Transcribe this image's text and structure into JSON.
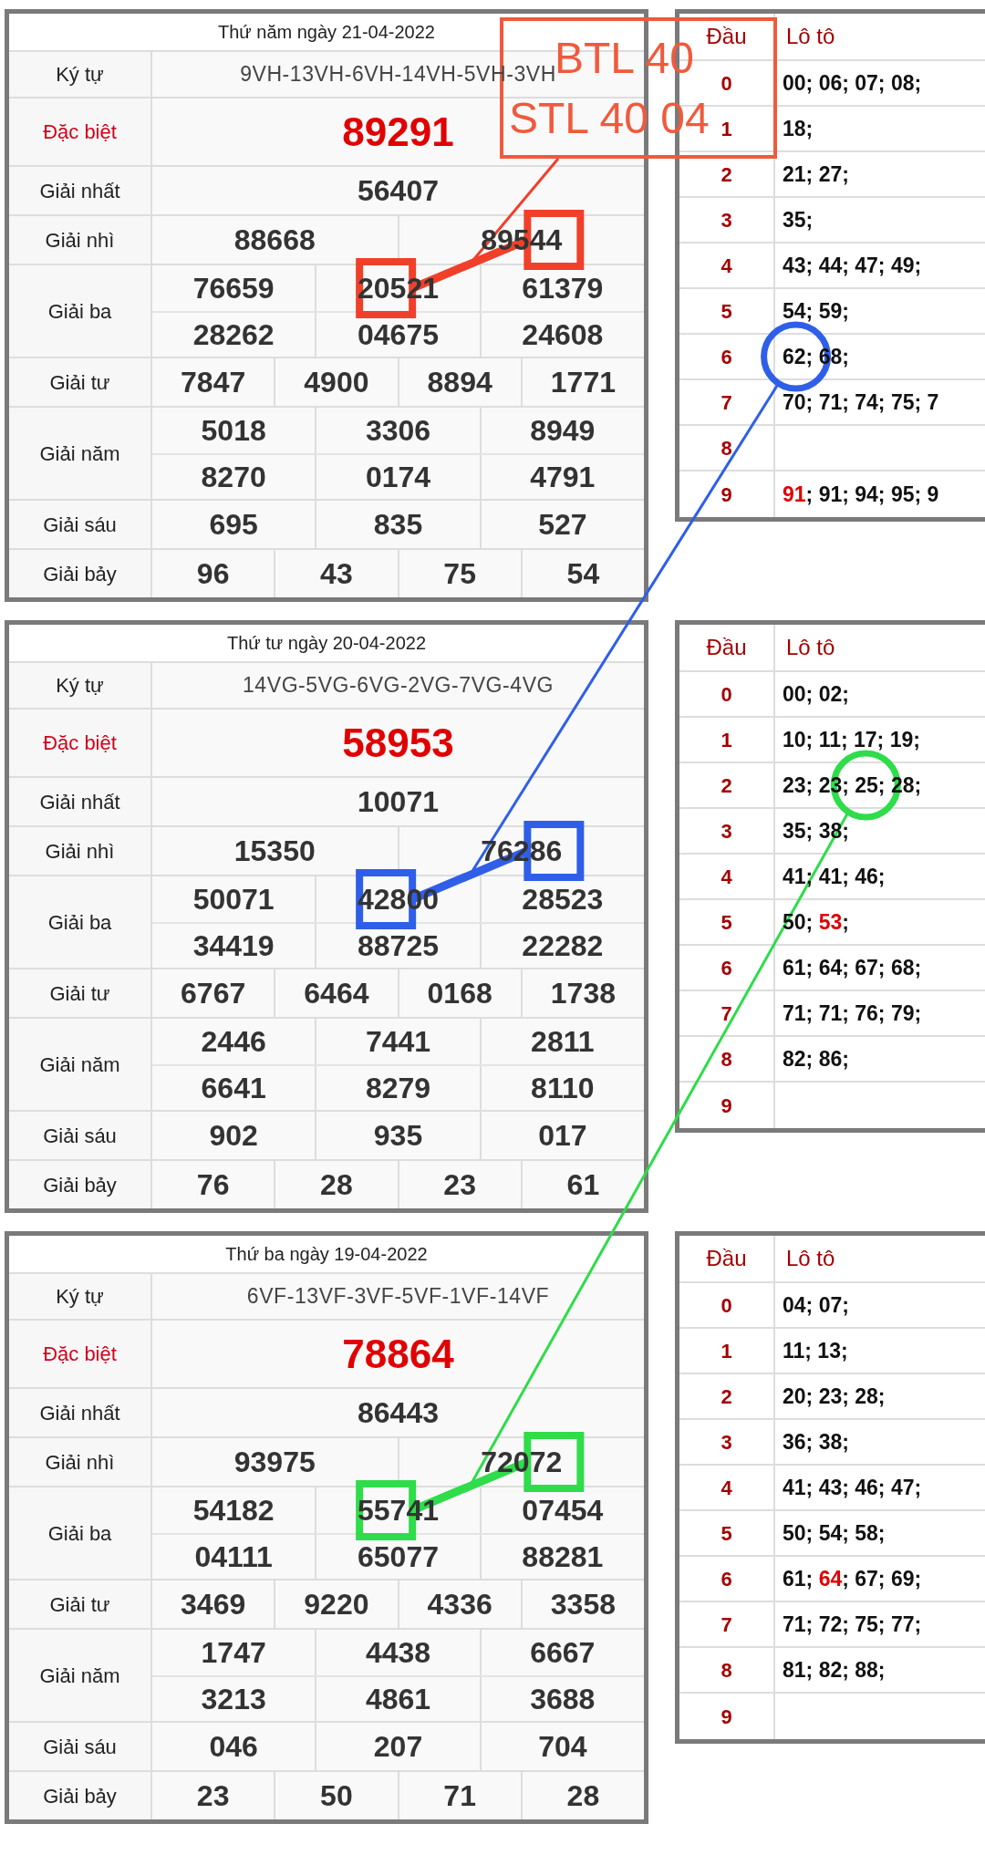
{
  "days": [
    {
      "title": "Thứ năm ngày 21-04-2022",
      "rows": [
        {
          "label": "Ký tự",
          "kind": "code",
          "values": [
            "9VH-13VH-6VH-14VH-5VH-3VH"
          ]
        },
        {
          "label": "Đặc biệt",
          "kind": "special",
          "values": [
            "89291"
          ]
        },
        {
          "label": "Giải nhất",
          "kind": "prize",
          "values": [
            "56407"
          ]
        },
        {
          "label": "Giải nhì",
          "kind": "prize",
          "values": [
            "88668",
            "89544"
          ]
        },
        {
          "label": "Giải ba",
          "kind": "prize",
          "values": [
            "76659",
            "20521",
            "61379",
            "28262",
            "04675",
            "24608"
          ]
        },
        {
          "label": "Giải tư",
          "kind": "prize",
          "values": [
            "7847",
            "4900",
            "8894",
            "1771"
          ]
        },
        {
          "label": "Giải năm",
          "kind": "prize",
          "values": [
            "5018",
            "3306",
            "8949",
            "8270",
            "0174",
            "4791"
          ]
        },
        {
          "label": "Giải sáu",
          "kind": "prize",
          "values": [
            "695",
            "835",
            "527"
          ]
        },
        {
          "label": "Giải bảy",
          "kind": "prize",
          "values": [
            "96",
            "43",
            "75",
            "54"
          ]
        }
      ],
      "loto": {
        "head_label": "Đầu",
        "list_label": "Lô tô",
        "rows": [
          {
            "head": "0",
            "parts": [
              {
                "text": "00; 06; 07; 08;",
                "highlight": false
              }
            ]
          },
          {
            "head": "1",
            "parts": [
              {
                "text": "18;",
                "highlight": false
              }
            ]
          },
          {
            "head": "2",
            "parts": [
              {
                "text": "21; 27;",
                "highlight": false
              }
            ]
          },
          {
            "head": "3",
            "parts": [
              {
                "text": "35;",
                "highlight": false
              }
            ]
          },
          {
            "head": "4",
            "parts": [
              {
                "text": "43; 44; 47; 49;",
                "highlight": false
              }
            ]
          },
          {
            "head": "5",
            "parts": [
              {
                "text": "54; 59;",
                "highlight": false
              }
            ]
          },
          {
            "head": "6",
            "parts": [
              {
                "text": "62; 68;",
                "highlight": false
              }
            ]
          },
          {
            "head": "7",
            "parts": [
              {
                "text": "70; 71; 74; 75; 7",
                "highlight": false
              }
            ]
          },
          {
            "head": "8",
            "parts": []
          },
          {
            "head": "9",
            "parts": [
              {
                "text": "91",
                "highlight": true
              },
              {
                "text": "; 91; 94; 95; 9",
                "highlight": false
              }
            ]
          }
        ]
      }
    },
    {
      "title": "Thứ tư ngày 20-04-2022",
      "rows": [
        {
          "label": "Ký tự",
          "kind": "code",
          "values": [
            "14VG-5VG-6VG-2VG-7VG-4VG"
          ]
        },
        {
          "label": "Đặc biệt",
          "kind": "special",
          "values": [
            "58953"
          ]
        },
        {
          "label": "Giải nhất",
          "kind": "prize",
          "values": [
            "10071"
          ]
        },
        {
          "label": "Giải nhì",
          "kind": "prize",
          "values": [
            "15350",
            "76286"
          ]
        },
        {
          "label": "Giải ba",
          "kind": "prize",
          "values": [
            "50071",
            "42800",
            "28523",
            "34419",
            "88725",
            "22282"
          ]
        },
        {
          "label": "Giải tư",
          "kind": "prize",
          "values": [
            "6767",
            "6464",
            "0168",
            "1738"
          ]
        },
        {
          "label": "Giải năm",
          "kind": "prize",
          "values": [
            "2446",
            "7441",
            "2811",
            "6641",
            "8279",
            "8110"
          ]
        },
        {
          "label": "Giải sáu",
          "kind": "prize",
          "values": [
            "902",
            "935",
            "017"
          ]
        },
        {
          "label": "Giải bảy",
          "kind": "prize",
          "values": [
            "76",
            "28",
            "23",
            "61"
          ]
        }
      ],
      "loto": {
        "head_label": "Đầu",
        "list_label": "Lô tô",
        "rows": [
          {
            "head": "0",
            "parts": [
              {
                "text": "00; 02;",
                "highlight": false
              }
            ]
          },
          {
            "head": "1",
            "parts": [
              {
                "text": "10; 11; 17; 19;",
                "highlight": false
              }
            ]
          },
          {
            "head": "2",
            "parts": [
              {
                "text": "23; 23; 25; 28;",
                "highlight": false
              }
            ]
          },
          {
            "head": "3",
            "parts": [
              {
                "text": "35; 38;",
                "highlight": false
              }
            ]
          },
          {
            "head": "4",
            "parts": [
              {
                "text": "41; 41; 46;",
                "highlight": false
              }
            ]
          },
          {
            "head": "5",
            "parts": [
              {
                "text": "50; ",
                "highlight": false
              },
              {
                "text": "53",
                "highlight": true
              },
              {
                "text": ";",
                "highlight": false
              }
            ]
          },
          {
            "head": "6",
            "parts": [
              {
                "text": "61; 64; 67; 68;",
                "highlight": false
              }
            ]
          },
          {
            "head": "7",
            "parts": [
              {
                "text": "71; 71; 76; 79;",
                "highlight": false
              }
            ]
          },
          {
            "head": "8",
            "parts": [
              {
                "text": "82; 86;",
                "highlight": false
              }
            ]
          },
          {
            "head": "9",
            "parts": []
          }
        ]
      }
    },
    {
      "title": "Thứ ba ngày 19-04-2022",
      "rows": [
        {
          "label": "Ký tự",
          "kind": "code",
          "values": [
            "6VF-13VF-3VF-5VF-1VF-14VF"
          ]
        },
        {
          "label": "Đặc biệt",
          "kind": "special",
          "values": [
            "78864"
          ]
        },
        {
          "label": "Giải nhất",
          "kind": "prize",
          "values": [
            "86443"
          ]
        },
        {
          "label": "Giải nhì",
          "kind": "prize",
          "values": [
            "93975",
            "72072"
          ]
        },
        {
          "label": "Giải ba",
          "kind": "prize",
          "values": [
            "54182",
            "55741",
            "07454",
            "04111",
            "65077",
            "88281"
          ]
        },
        {
          "label": "Giải tư",
          "kind": "prize",
          "values": [
            "3469",
            "9220",
            "4336",
            "3358"
          ]
        },
        {
          "label": "Giải năm",
          "kind": "prize",
          "values": [
            "1747",
            "4438",
            "6667",
            "3213",
            "4861",
            "3688"
          ]
        },
        {
          "label": "Giải sáu",
          "kind": "prize",
          "values": [
            "046",
            "207",
            "704"
          ]
        },
        {
          "label": "Giải bảy",
          "kind": "prize",
          "values": [
            "23",
            "50",
            "71",
            "28"
          ]
        }
      ],
      "loto": {
        "head_label": "Đầu",
        "list_label": "Lô tô",
        "rows": [
          {
            "head": "0",
            "parts": [
              {
                "text": "04; 07;",
                "highlight": false
              }
            ]
          },
          {
            "head": "1",
            "parts": [
              {
                "text": "11; 13;",
                "highlight": false
              }
            ]
          },
          {
            "head": "2",
            "parts": [
              {
                "text": "20; 23; 28;",
                "highlight": false
              }
            ]
          },
          {
            "head": "3",
            "parts": [
              {
                "text": "36; 38;",
                "highlight": false
              }
            ]
          },
          {
            "head": "4",
            "parts": [
              {
                "text": "41; 43; 46; 47;",
                "highlight": false
              }
            ]
          },
          {
            "head": "5",
            "parts": [
              {
                "text": "50; 54; 58;",
                "highlight": false
              }
            ]
          },
          {
            "head": "6",
            "parts": [
              {
                "text": "61; ",
                "highlight": false
              },
              {
                "text": "64",
                "highlight": true
              },
              {
                "text": "; 67; 69;",
                "highlight": false
              }
            ]
          },
          {
            "head": "7",
            "parts": [
              {
                "text": "71; 72; 75; 77;",
                "highlight": false
              }
            ]
          },
          {
            "head": "8",
            "parts": [
              {
                "text": "81; 82; 88;",
                "highlight": false
              }
            ]
          },
          {
            "head": "9",
            "parts": []
          }
        ]
      }
    }
  ],
  "annotation": {
    "lines": [
      "BTL 40",
      "STL 40 04"
    ]
  }
}
